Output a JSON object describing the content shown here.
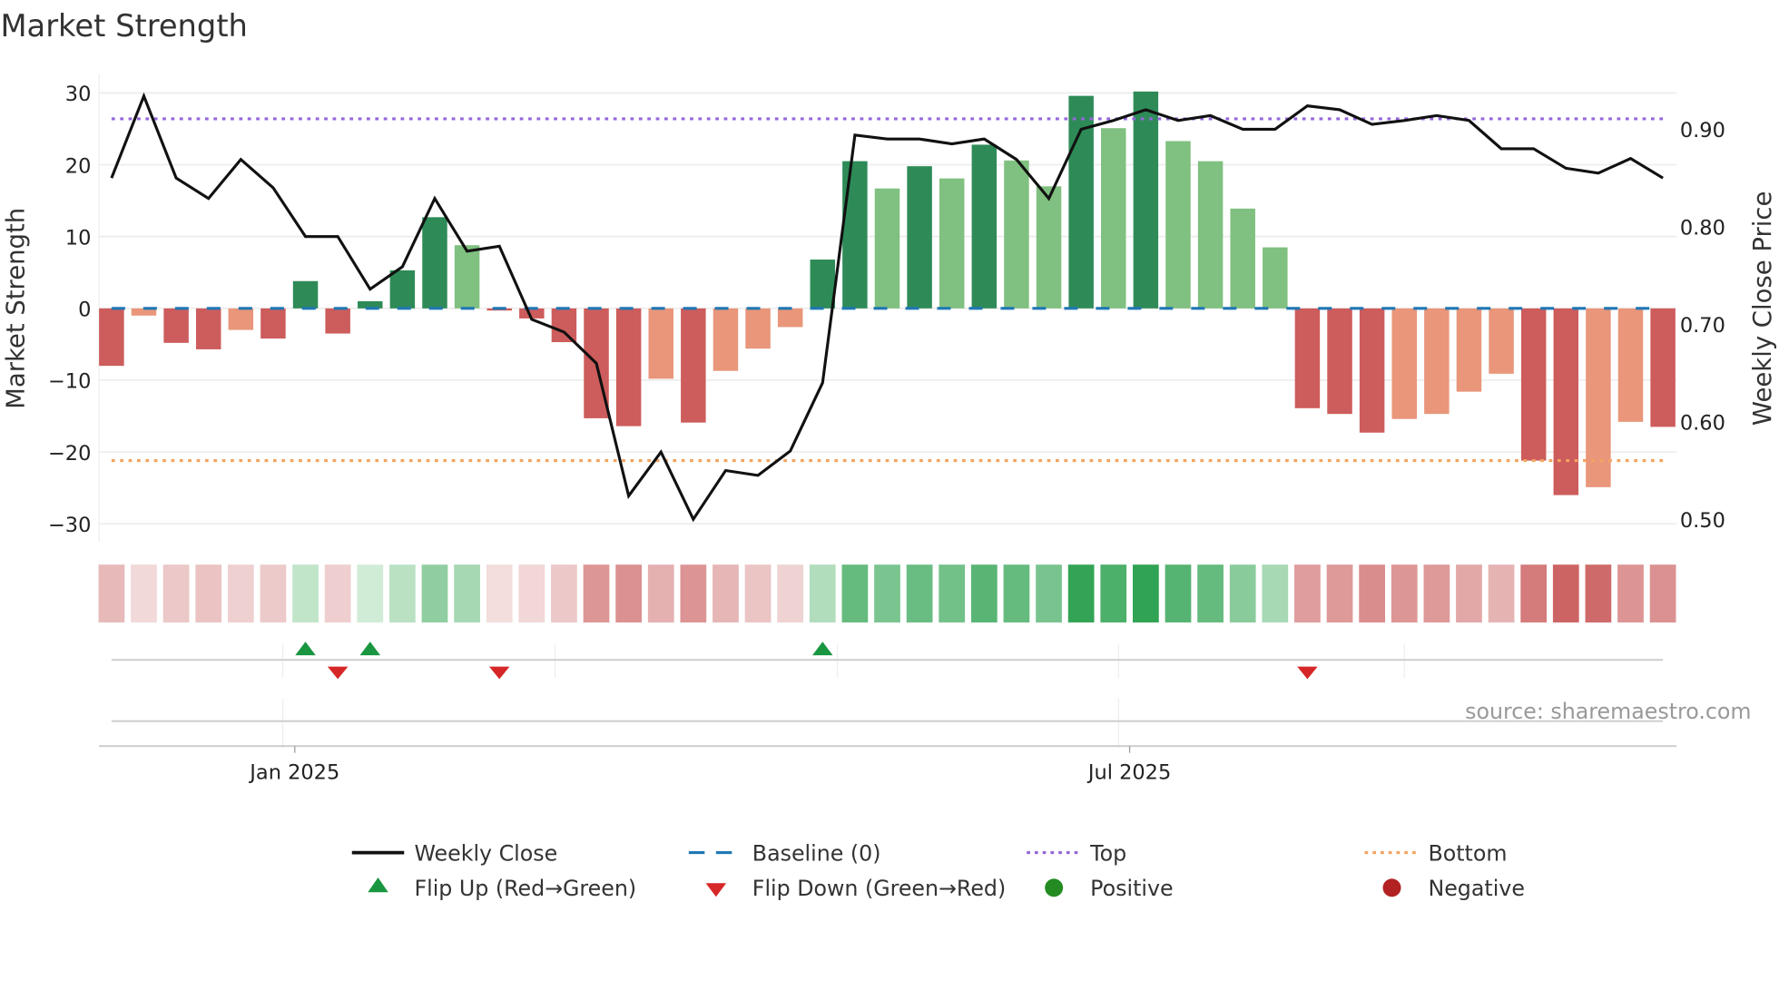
{
  "chart_data": {
    "type": "bar",
    "title": "Market Strength",
    "ylabel": "Market Strength",
    "y2label": "Weekly Close Price",
    "ylim": [
      -33,
      33
    ],
    "y2lim": [
      0.48,
      0.96
    ],
    "yticks": [
      30,
      20,
      10,
      0,
      -10,
      -20,
      -30
    ],
    "ytick_labels": [
      "30",
      "20",
      "10",
      "0",
      "−10",
      "−20",
      "−30"
    ],
    "y2ticks": [
      0.9,
      0.8,
      0.7,
      0.6,
      0.5
    ],
    "y2tick_labels": [
      "0.90",
      "0.80",
      "0.70",
      "0.60",
      "0.50"
    ],
    "xtick_labels": [
      "Jan 2025",
      "Jul 2025"
    ],
    "xtick_index": [
      5.67,
      31.5
    ],
    "grid": true,
    "strength": [
      -8,
      -1,
      -4.8,
      -5.7,
      -3,
      -4.2,
      3.8,
      -3.5,
      1,
      5.3,
      12.7,
      8.8,
      -0.3,
      -1.4,
      -4.7,
      -15.3,
      -16.4,
      -9.8,
      -15.9,
      -8.7,
      -5.6,
      -2.6,
      6.8,
      20.5,
      16.7,
      19.8,
      18.1,
      22.8,
      20.6,
      17.0,
      29.6,
      25.1,
      30.2,
      23.3,
      20.5,
      13.9,
      8.5,
      -13.9,
      -14.7,
      -17.3,
      -15.4,
      -14.7,
      -11.6,
      -9.1,
      -21.2,
      -26.0,
      -24.9,
      -15.8,
      -16.5
    ],
    "weekly_close": [
      0.85,
      0.934,
      0.85,
      0.829,
      0.869,
      0.84,
      0.79,
      0.79,
      0.736,
      0.759,
      0.829,
      0.775,
      0.78,
      0.705,
      0.692,
      0.66,
      0.524,
      0.569,
      0.5,
      0.55,
      0.545,
      0.57,
      0.64,
      0.894,
      0.89,
      0.89,
      0.885,
      0.89,
      0.869,
      0.829,
      0.9,
      0.909,
      0.92,
      0.909,
      0.914,
      0.9,
      0.9,
      0.924,
      0.92,
      0.905,
      0.909,
      0.914,
      0.909,
      0.88,
      0.88,
      0.86,
      0.855,
      0.87,
      0.85
    ],
    "top_line": 26.4,
    "bottom_line": -21.2,
    "baseline": 0,
    "flip_up_index": [
      6,
      8,
      22
    ],
    "flip_down_index": [
      7,
      12,
      37
    ],
    "legend_position": "bottom",
    "colors": {
      "pos_strong": "#2e8b57",
      "pos_weak": "#80c080",
      "neg_strong": "#cd5c5c",
      "neg_weak": "#e9967a",
      "close": "#111111",
      "baseline": "#1f77b4",
      "top": "#9467dd",
      "bottom": "#f4a460",
      "flip_up": "#1a9641",
      "flip_down": "#d62728",
      "positive": "#238b22",
      "negative": "#b22222"
    }
  },
  "source": "source: sharemaestro.com",
  "legend": {
    "weekly_close": "Weekly Close",
    "baseline": "Baseline (0)",
    "top": "Top",
    "bottom": "Bottom",
    "flip_up": "Flip Up (Red→Green)",
    "flip_down": "Flip Down (Green→Red)",
    "positive": "Positive",
    "negative": "Negative"
  }
}
